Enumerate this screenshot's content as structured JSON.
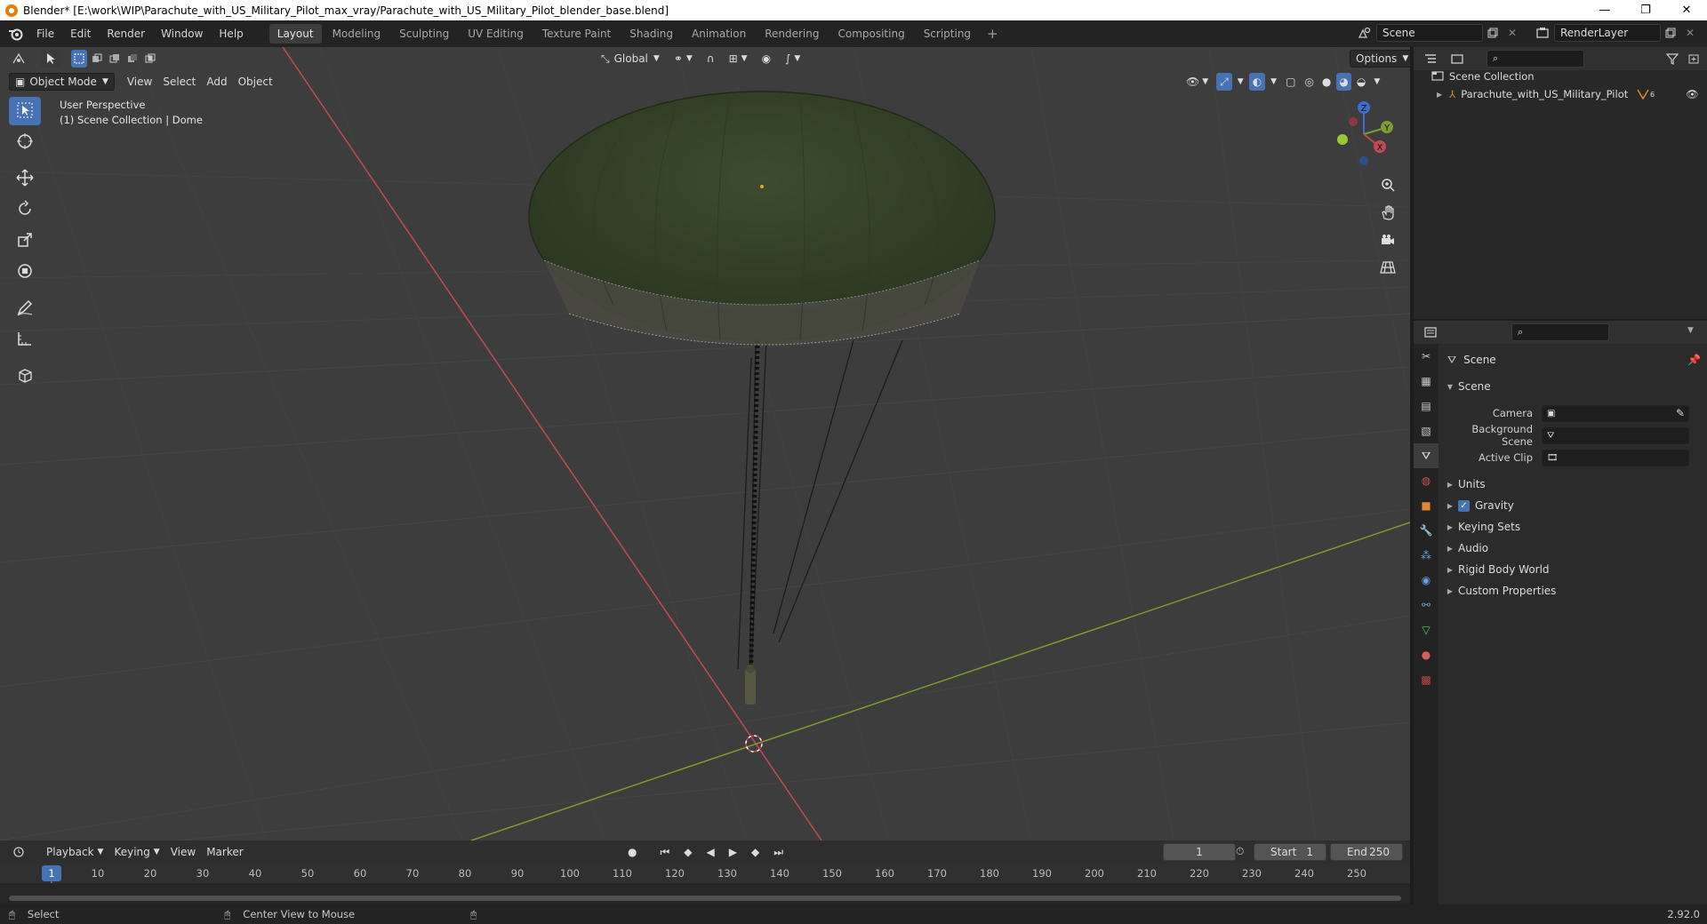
{
  "window": {
    "title": "Blender* [E:\\work\\WIP\\Parachute_with_US_Military_Pilot_max_vray/Parachute_with_US_Military_Pilot_blender_base.blend]",
    "minimize": "—",
    "maximize": "❐",
    "close": "✕"
  },
  "menu": [
    "File",
    "Edit",
    "Render",
    "Window",
    "Help"
  ],
  "workspaces": [
    "Layout",
    "Modeling",
    "Sculpting",
    "UV Editing",
    "Texture Paint",
    "Shading",
    "Animation",
    "Rendering",
    "Compositing",
    "Scripting"
  ],
  "active_workspace": "Layout",
  "scene_selector": {
    "label": "Scene"
  },
  "viewlayer_selector": {
    "label": "RenderLayer"
  },
  "viewport": {
    "transform_orientation": "Global",
    "options_label": "Options",
    "mode": "Object Mode",
    "menus": [
      "View",
      "Select",
      "Add",
      "Object"
    ],
    "overlay_line1": "User Perspective",
    "overlay_line2": "(1) Scene Collection | Dome",
    "gizmo_axes": {
      "x": "X",
      "y": "Y",
      "z": "Z"
    }
  },
  "outliner": {
    "root": "Scene Collection",
    "items": [
      {
        "label": "Parachute_with_US_Military_Pilot",
        "badge": "6"
      }
    ]
  },
  "properties": {
    "context_title": "Scene",
    "scene_panel": "Scene",
    "fields": {
      "camera_label": "Camera",
      "background_scene_label": "Background Scene",
      "active_clip_label": "Active Clip"
    },
    "panels": [
      "Units",
      "Gravity",
      "Keying Sets",
      "Audio",
      "Rigid Body World",
      "Custom Properties"
    ],
    "gravity_checked": true
  },
  "timeline": {
    "menus": [
      "Playback",
      "Keying",
      "View",
      "Marker"
    ],
    "current_frame": "1",
    "start_label": "Start",
    "start_value": "1",
    "end_label": "End",
    "end_value": "250",
    "ruler": [
      "1",
      "10",
      "20",
      "30",
      "40",
      "50",
      "60",
      "70",
      "80",
      "90",
      "100",
      "110",
      "120",
      "130",
      "140",
      "150",
      "160",
      "170",
      "180",
      "190",
      "200",
      "210",
      "220",
      "230",
      "240",
      "250"
    ]
  },
  "statusbar": {
    "left": "Select",
    "middle": "Center View to Mouse",
    "version": "2.92.0"
  },
  "colors": {
    "accent": "#4772b3",
    "x_axis": "#c24a54",
    "y_axis": "#7d9d2d",
    "canopy": "#3a4a2a"
  }
}
